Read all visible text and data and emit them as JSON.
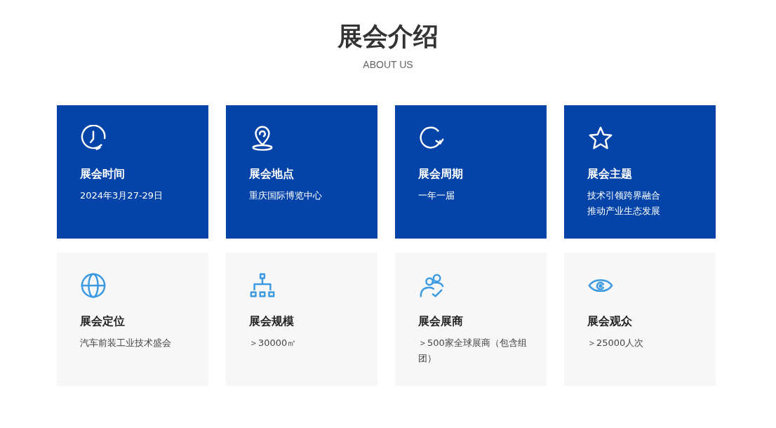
{
  "heading": {
    "title": "展会介绍",
    "subtitle": "ABOUT US"
  },
  "cards": [
    {
      "kind": "highlight",
      "title": "展会时间",
      "lines": [
        "2024年3月27-29日"
      ]
    },
    {
      "kind": "highlight",
      "title": "展会地点",
      "lines": [
        "重庆国际博览中心"
      ]
    },
    {
      "kind": "highlight",
      "title": "展会周期",
      "lines": [
        "一年一届"
      ]
    },
    {
      "kind": "highlight",
      "title": "展会主题",
      "lines": [
        "技术引领跨界融合",
        "推动产业生态发展"
      ]
    },
    {
      "kind": "plain",
      "title": "展会定位",
      "lines": [
        "汽车前装工业技术盛会"
      ]
    },
    {
      "kind": "plain",
      "title": "展会规模",
      "lines": [
        "＞30000㎡"
      ]
    },
    {
      "kind": "plain",
      "title": "展会展商",
      "lines": [
        "＞500家全球展商（包含组团）"
      ]
    },
    {
      "kind": "plain",
      "title": "展会观众",
      "lines": [
        "＞25000人次"
      ]
    }
  ]
}
